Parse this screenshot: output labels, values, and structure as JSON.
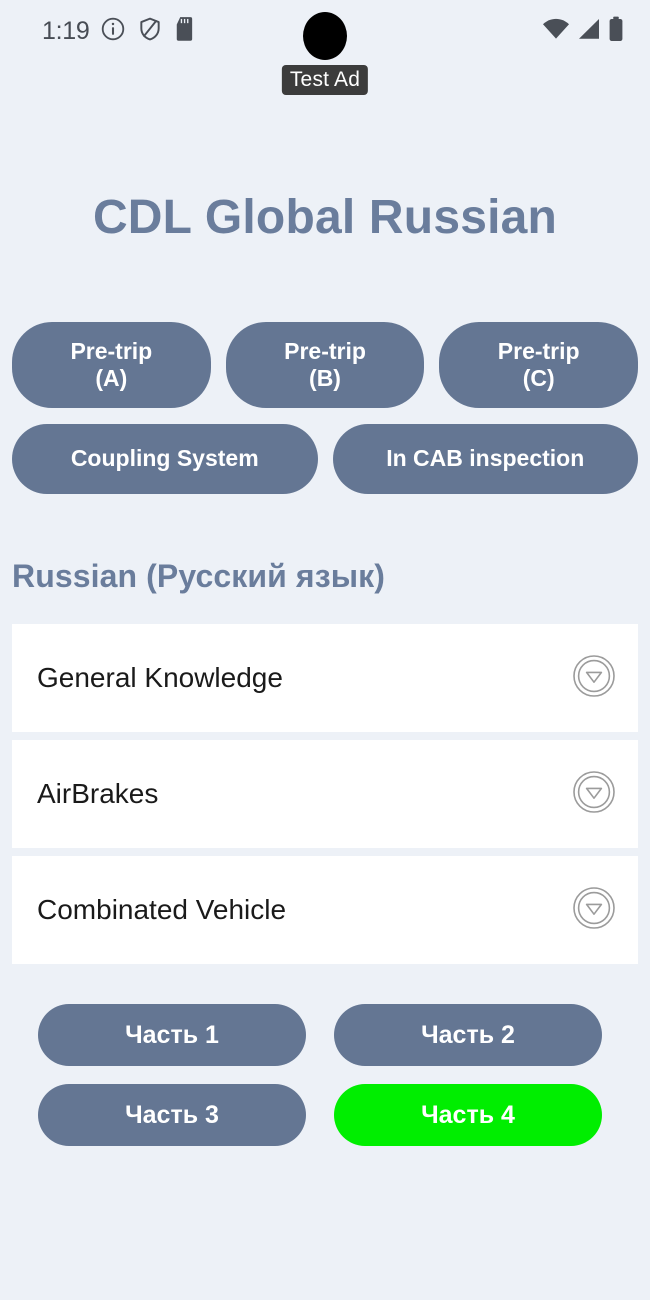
{
  "status_bar": {
    "time": "1:19",
    "left_icons": [
      "info-icon",
      "shield-off-icon",
      "sd-card-icon"
    ],
    "right_icons": [
      "wifi-icon",
      "cellular-signal-icon",
      "battery-icon"
    ]
  },
  "ad": {
    "badge_label": "Test Ad"
  },
  "header": {
    "title": "CDL Global Russian"
  },
  "colors": {
    "background": "#edf1f7",
    "accent_slate": "#647693",
    "title_slate": "#6a7d9c",
    "active_green": "#00ee00",
    "card_white": "#ffffff",
    "badge_dark": "#3c3c3c"
  },
  "pretrip_buttons": [
    {
      "line1": "Pre-trip",
      "line2": "(A)"
    },
    {
      "line1": "Pre-trip",
      "line2": "(B)"
    },
    {
      "line1": "Pre-trip",
      "line2": "(C)"
    }
  ],
  "inspection_buttons": [
    {
      "label": "Coupling System"
    },
    {
      "label": "In CAB inspection"
    }
  ],
  "section": {
    "heading": "Russian (Русский язык)"
  },
  "topics": [
    {
      "label": "General Knowledge",
      "expander_icon": "chevron-down-circle-icon"
    },
    {
      "label": "AirBrakes",
      "expander_icon": "chevron-down-circle-icon"
    },
    {
      "label": "Combinated Vehicle",
      "expander_icon": "chevron-down-circle-icon"
    }
  ],
  "parts": [
    {
      "label": "Часть 1",
      "active": false
    },
    {
      "label": "Часть 2",
      "active": false
    },
    {
      "label": "Часть 3",
      "active": false
    },
    {
      "label": "Часть 4",
      "active": true
    }
  ]
}
